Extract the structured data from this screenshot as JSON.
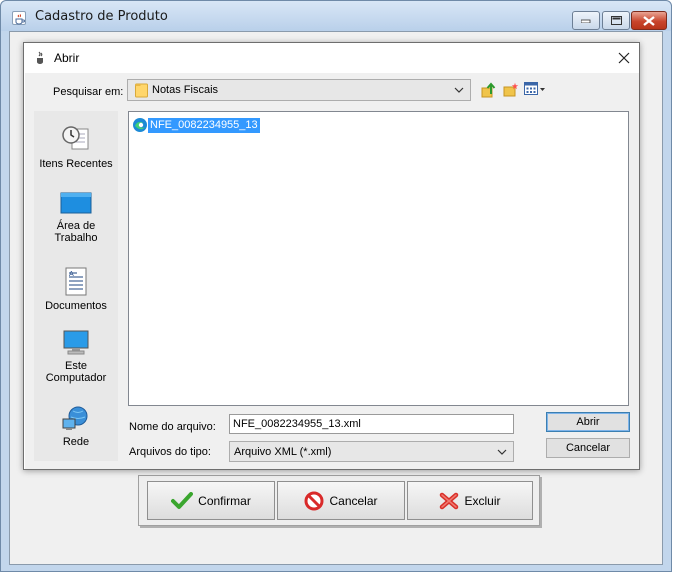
{
  "outer_window": {
    "title": "Cadastro de Produto",
    "buttons": {
      "confirm": "Confirmar",
      "cancel": "Cancelar",
      "delete": "Excluir"
    }
  },
  "dialog": {
    "title": "Abrir",
    "look_in_label": "Pesquisar em:",
    "look_in_value": "Notas Fiscais",
    "places": [
      {
        "label": "Itens Recentes",
        "icon": "recent-items-icon"
      },
      {
        "label": "Área de Trabalho",
        "icon": "desktop-icon"
      },
      {
        "label": "Documentos",
        "icon": "documents-icon"
      },
      {
        "label": "Este Computador",
        "icon": "computer-icon"
      },
      {
        "label": "Rede",
        "icon": "network-icon"
      }
    ],
    "files": [
      {
        "name": "NFE_0082234955_13",
        "selected": true,
        "icon": "edge-file-icon"
      }
    ],
    "file_name_label": "Nome do arquivo:",
    "file_name_value": "NFE_0082234955_13.xml",
    "file_type_label": "Arquivos do tipo:",
    "file_type_value": "Arquivo XML (*.xml)",
    "open_button": "Abrir",
    "cancel_button": "Cancelar"
  },
  "colors": {
    "selection": "#3399ff",
    "title_frame": "#c2d6ec",
    "dialog_bg": "#f0f0f0"
  }
}
